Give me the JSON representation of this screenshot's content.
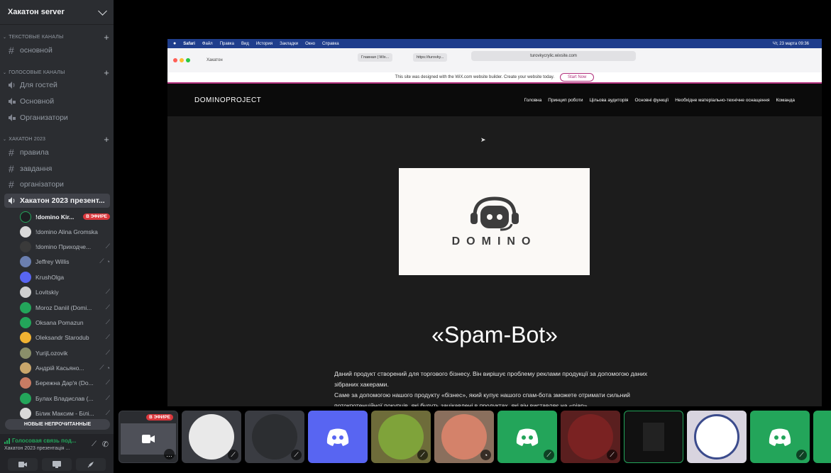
{
  "server": {
    "name": "Хакатон server"
  },
  "categories": {
    "text": "ТЕКСТОВЫЕ КАНАЛЫ",
    "voice": "ГОЛОСОВЫЕ КАНАЛЫ",
    "hackathon": "ХАКАТОН 2023"
  },
  "channels": {
    "text_main": "основной",
    "voice_guests": "Для гостей",
    "voice_main": "Основной",
    "voice_orgs": "Организатори",
    "rules": "правила",
    "tasks": "завдання",
    "organizers": "організатори",
    "stage_active": "Хакатон 2023 презент..."
  },
  "users": [
    {
      "name": "!domino Kir...",
      "badge": "В ЭФИРЕ",
      "color": "#1e1f22"
    },
    {
      "name": "!domino Alina Gromska",
      "color": "#d9d9d9"
    },
    {
      "name": "!domino Приходче...",
      "color": "#3a3a3a"
    },
    {
      "name": "Jeffrey Willis",
      "color": "#6b7fb0"
    },
    {
      "name": "KrushOlga",
      "color": "#5865f2"
    },
    {
      "name": "Lovitskiy",
      "color": "#cfcfcf"
    },
    {
      "name": "Moroz Daniil (Domi...",
      "color": "#23a55a"
    },
    {
      "name": "Oksana Pomazun",
      "color": "#23a55a"
    },
    {
      "name": "Oleksandr Starodub",
      "color": "#f0b232"
    },
    {
      "name": "YurijLozovik",
      "color": "#8a8f6a"
    },
    {
      "name": "Андрій Касьяно...",
      "color": "#c9a66b"
    },
    {
      "name": "Бережна Дар'я (Do...",
      "color": "#c97b63"
    },
    {
      "name": "Булах Владислав (...",
      "color": "#23a55a"
    },
    {
      "name": "Білик Максим - Білі...",
      "color": "#d9d9d9"
    }
  ],
  "unread_label": "НОВЫЕ НЕПРОЧИТАННЫЕ",
  "voice_panel": {
    "status": "Голосовая связь под...",
    "channel": "Хакатон 2023 презентація ..."
  },
  "browser": {
    "mac_menu": [
      "Safari",
      "Файл",
      "Правка",
      "Вид",
      "История",
      "Закладки",
      "Окно",
      "Справка"
    ],
    "mac_status": "Чт, 23 марта 09:36",
    "window_title": "Хакатон",
    "tab1": "Главная | Wix...",
    "tab2": "https://turovky...",
    "url": "turovkycrylic.wixsite.com",
    "wix_notice": "This site was designed with the WiX.com website builder. Create your website today.",
    "start_now": "Start Now"
  },
  "site": {
    "logo": "DOMINOPROJECT",
    "nav": [
      "Головна",
      "Принцип роботи",
      "Цільова аудиторія",
      "Основні функції",
      "Необхідне матеріально-технічне оснащення",
      "Команда"
    ],
    "brand_text": "DOMINO",
    "title": "«Spam-Bot»",
    "desc_line1": "Даний продукт створений для торгового бізнесу. Він вирішує проблему реклами продукції за допомогою даних зібраних хакерами.",
    "desc_line2": "Саме за допомогою нашого продукту «бізнес», який купує нашого спам-бота зможете отримати сильний потокпотенційної покупців, які будуть зацікавлені в продуктах, які він виставляє на «ріар»"
  },
  "tiles": {
    "live_badge": "В ЭФИРЕ"
  },
  "colors": {
    "accent": "#5865f2",
    "green": "#23a55a",
    "red": "#da373c"
  }
}
